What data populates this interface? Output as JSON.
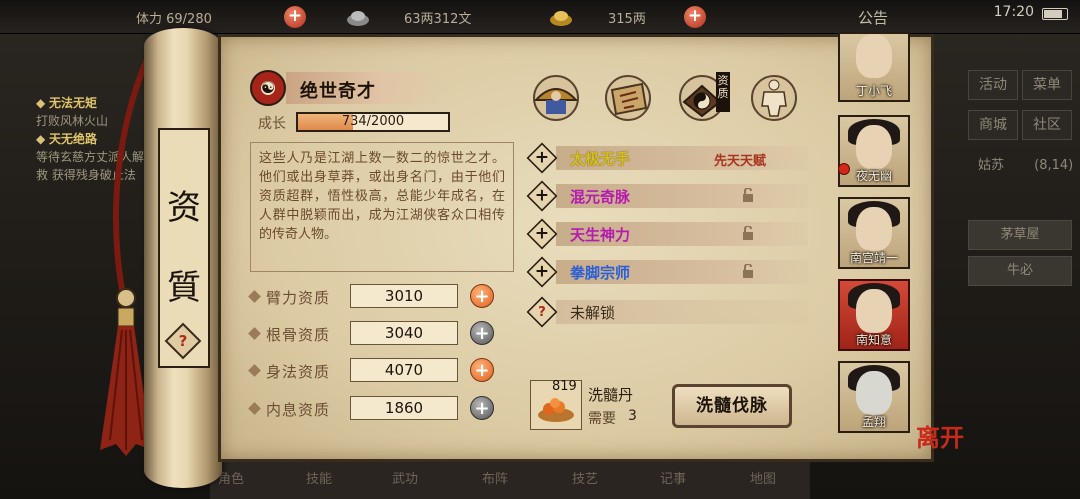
{
  "topbar": {
    "stamina": "体力 69/280",
    "silver": "63两312文",
    "gold": "315两",
    "notice": "公告",
    "time": "17:20"
  },
  "left_bg": {
    "items": [
      {
        "title": "无法无矩",
        "text": "打败风林火山"
      },
      {
        "title": "天无绝路",
        "text": "等待玄慈方丈派人解救 获得残身破止法"
      }
    ]
  },
  "right_bg": {
    "buttons": [
      "活动",
      "菜单",
      "商城",
      "社区"
    ],
    "location": "姑苏",
    "coords": "(8,14)",
    "slots": [
      "茅草屋",
      "牛必"
    ]
  },
  "bottom_bar": [
    "角色",
    "技能",
    "武功",
    "布阵",
    "技艺",
    "记事",
    "地图"
  ],
  "panel": {
    "vertical_title": [
      "资",
      "質"
    ],
    "help": "?",
    "name_icon": "☯",
    "name": "绝世奇才",
    "growth_label": "成长",
    "growth_value": "734/2000",
    "growth_current": 734,
    "growth_max": 2000,
    "description": "这些人乃是江湖上数一数二的惊世之才。他们或出身草莽，或出身名门，由于他们资质超群，悟性极高，总能少年成名，在人群中脱颖而出，成为江湖侠客众口相传的传奇人物。",
    "stats": [
      {
        "label": "臂力资质",
        "value": "3010",
        "button": "+",
        "button_color": "orange"
      },
      {
        "label": "根骨资质",
        "value": "3040",
        "button": "+",
        "button_color": "gray"
      },
      {
        "label": "身法资质",
        "value": "4070",
        "button": "+",
        "button_color": "orange"
      },
      {
        "label": "内息资质",
        "value": "1860",
        "button": "+",
        "button_color": "gray"
      }
    ],
    "tabs": [
      {
        "icon": "straw-hat-icon"
      },
      {
        "icon": "map-scroll-icon"
      },
      {
        "icon": "yin-yang-icon",
        "label": "资质"
      },
      {
        "icon": "body-icon"
      }
    ],
    "skills": [
      {
        "name": "太极无手",
        "color": "#d8c21a",
        "tag": "先天天赋",
        "locked": false
      },
      {
        "name": "混元奇脉",
        "color": "#b51bb0",
        "tag": "",
        "locked": true
      },
      {
        "name": "天生神力",
        "color": "#b51bb0",
        "tag": "",
        "locked": true
      },
      {
        "name": "拳脚宗师",
        "color": "#2b5fd4",
        "tag": "",
        "locked": true
      }
    ],
    "unlock": {
      "icon": "?",
      "label": "未解锁"
    },
    "wash": {
      "count": "819",
      "name": "洗髓丹",
      "need_label": "需要",
      "need_value": "3",
      "button": "洗髓伐脉"
    }
  },
  "roster": [
    {
      "name": "丁小飞",
      "selected": false
    },
    {
      "name": "夜无幽",
      "selected": false
    },
    {
      "name": "南宫靖一",
      "selected": false
    },
    {
      "name": "南知意",
      "selected": true
    },
    {
      "name": "孟翔",
      "selected": false
    }
  ],
  "leave_label": "离开",
  "colors": {
    "accent_red": "#c92a1a",
    "paper": "#e3d4b0",
    "stat_plus_orange": "#e0621f"
  }
}
